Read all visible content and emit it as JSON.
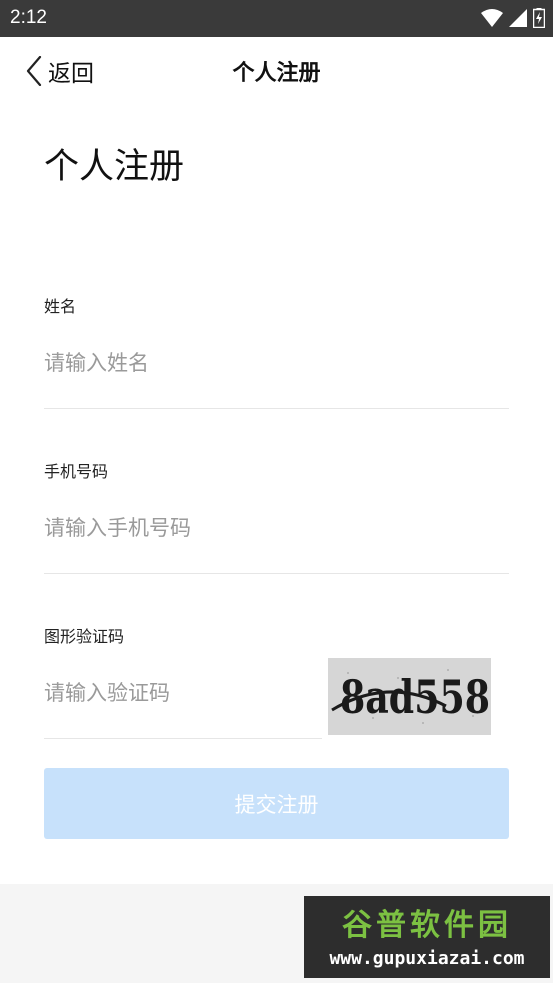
{
  "status_bar": {
    "time": "2:12"
  },
  "nav": {
    "back_label": "返回",
    "title": "个人注册"
  },
  "page": {
    "heading": "个人注册"
  },
  "form": {
    "name": {
      "label": "姓名",
      "placeholder": "请输入姓名",
      "value": ""
    },
    "phone": {
      "label": "手机号码",
      "placeholder": "请输入手机号码",
      "value": ""
    },
    "captcha": {
      "label": "图形验证码",
      "placeholder": "请输入验证码",
      "value": "",
      "image_text": "8ad558"
    }
  },
  "submit": {
    "label": "提交注册",
    "state": "disabled"
  },
  "watermark": {
    "logo_text": "谷普软件园",
    "url": "www.gupuxiazai.com"
  },
  "colors": {
    "status_bar": "#3a3a3a",
    "submit_disabled": "#c7e1fb",
    "placeholder": "#9a9a9a",
    "watermark_green": "#7cc142"
  }
}
